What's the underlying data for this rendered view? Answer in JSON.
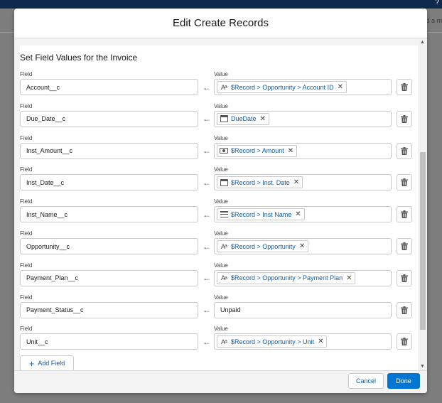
{
  "background": {
    "page_text": "d a m"
  },
  "modal": {
    "title": "Edit Create Records",
    "section_title": "Set Field Values for the Invoice",
    "field_label": "Field",
    "value_label": "Value",
    "rows": [
      {
        "field": "Account__c",
        "value": "$Record > Opportunity > Account ID",
        "icon": "text-type-icon"
      },
      {
        "field": "Due_Date__c",
        "value": "DueDate",
        "icon": "calendar-icon"
      },
      {
        "field": "Inst_Amount__c",
        "value": "$Record > Amount",
        "icon": "currency-icon"
      },
      {
        "field": "Inst_Date__c",
        "value": "$Record > Inst. Date",
        "icon": "calendar-icon"
      },
      {
        "field": "Inst_Name__c",
        "value": "$Record > Inst Name",
        "icon": "picklist-icon"
      },
      {
        "field": "Opportunity__c",
        "value": "$Record > Opportunity",
        "icon": "text-type-icon"
      },
      {
        "field": "Payment_Plan__c",
        "value": "$Record > Opportunity > Payment Plan",
        "icon": "text-type-icon"
      },
      {
        "field": "Payment_Status__c",
        "value": "Unpaid",
        "icon": ""
      },
      {
        "field": "Unit__c",
        "value": "$Record > Opportunity > Unit",
        "icon": "text-type-icon"
      }
    ],
    "add_field_label": "Add Field",
    "cancel_label": "Cancel",
    "done_label": "Done"
  },
  "colors": {
    "brand": "#0176d3",
    "link": "#0b5cab",
    "border": "#c9c9c9",
    "header_bar": "#0d2a4d"
  }
}
